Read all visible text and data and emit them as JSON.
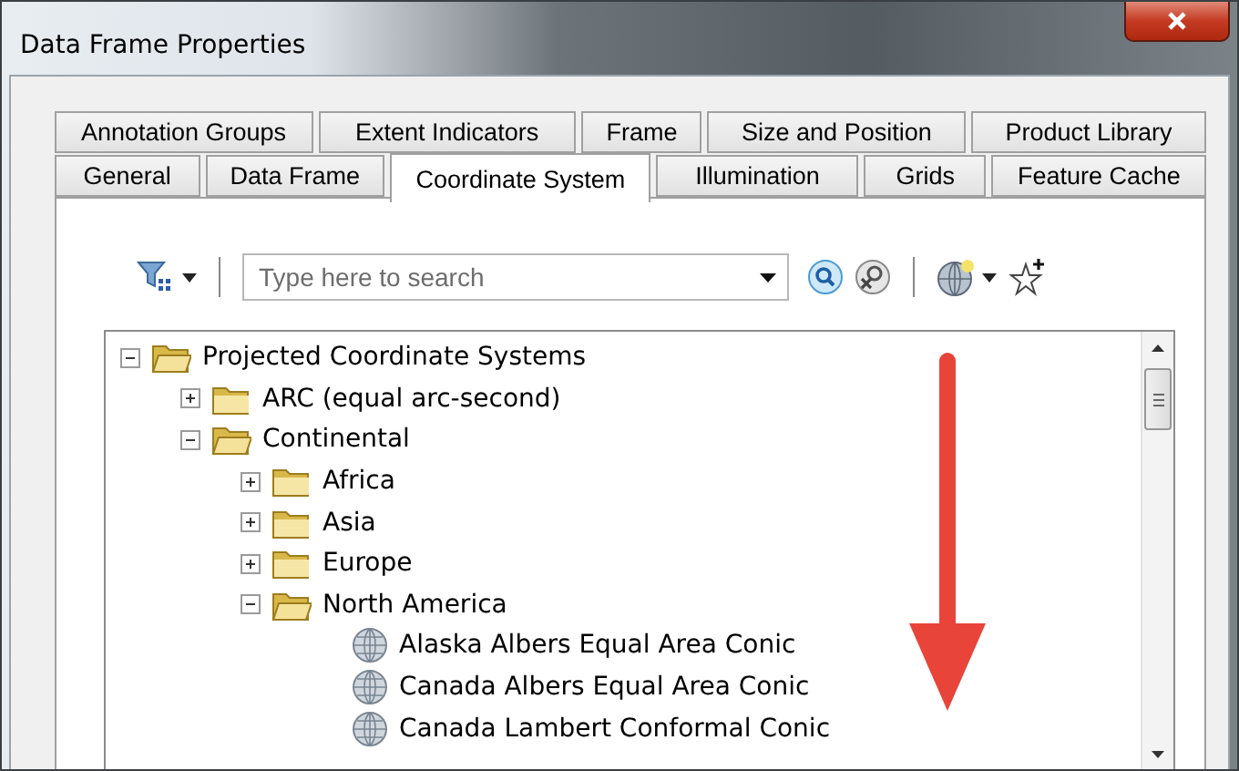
{
  "window": {
    "title": "Data Frame Properties"
  },
  "tab_rows": [
    {
      "tabs": [
        {
          "label": "Annotation Groups",
          "selected": false
        },
        {
          "label": "Extent Indicators",
          "selected": false
        },
        {
          "label": "Frame",
          "selected": false
        },
        {
          "label": "Size and Position",
          "selected": false
        },
        {
          "label": "Product Library",
          "selected": false
        }
      ]
    },
    {
      "tabs": [
        {
          "label": "General",
          "selected": false
        },
        {
          "label": "Data Frame",
          "selected": false
        },
        {
          "label": "Coordinate System",
          "selected": true
        },
        {
          "label": "Illumination",
          "selected": false
        },
        {
          "label": "Grids",
          "selected": false
        },
        {
          "label": "Feature Cache",
          "selected": false
        }
      ]
    }
  ],
  "search": {
    "placeholder": "Type here to search"
  },
  "tree": [
    {
      "label": "Projected Coordinate Systems",
      "kind": "folder",
      "expanded": true,
      "children": [
        {
          "label": "ARC (equal arc-second)",
          "kind": "folder",
          "expanded": false
        },
        {
          "label": "Continental",
          "kind": "folder",
          "expanded": true,
          "children": [
            {
              "label": "Africa",
              "kind": "folder",
              "expanded": false
            },
            {
              "label": "Asia",
              "kind": "folder",
              "expanded": false
            },
            {
              "label": "Europe",
              "kind": "folder",
              "expanded": false
            },
            {
              "label": "North America",
              "kind": "folder",
              "expanded": true,
              "children": [
                {
                  "label": "Alaska Albers Equal Area Conic",
                  "kind": "projection"
                },
                {
                  "label": "Canada Albers Equal Area Conic",
                  "kind": "projection"
                },
                {
                  "label": "Canada Lambert Conformal Conic",
                  "kind": "projection"
                }
              ]
            }
          ]
        }
      ]
    }
  ]
}
